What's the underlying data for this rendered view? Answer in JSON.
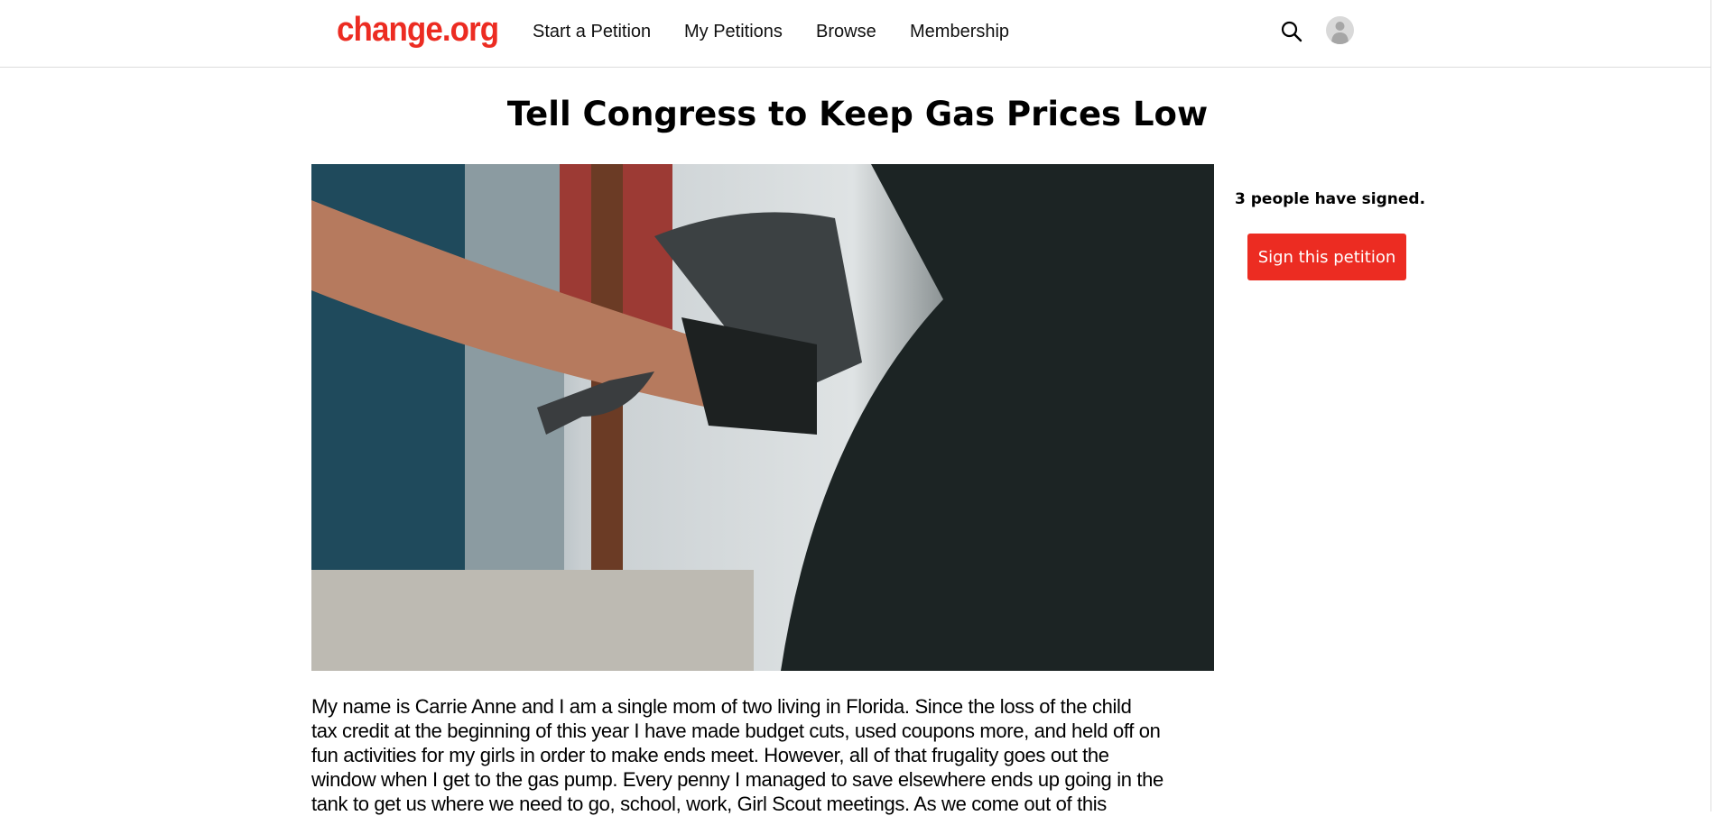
{
  "header": {
    "logo": "change.org",
    "nav": [
      "Start a Petition",
      "My Petitions",
      "Browse",
      "Membership"
    ],
    "icons": [
      "search-icon",
      "avatar-icon"
    ]
  },
  "petition": {
    "title": "Tell Congress to Keep Gas Prices Low",
    "image_alt": "Hand pumping gas into a car",
    "signed_text": "3 people have signed.",
    "sign_button": "Sign this petition",
    "body_lines": [
      "My name is Carrie Anne and I am a single mom of two living in Florida. Since the loss of the child",
      "tax credit at the beginning of this year I have made budget cuts, used coupons more, and held off on",
      "fun activities for my girls in order to make ends meet. However, all of that frugality goes out the",
      "window when I get to the gas pump. Every penny I managed to save elsewhere ends up going in the",
      "tank to get us where we need to go, school, work, Girl Scout meetings. As we come out of this"
    ]
  },
  "colors": {
    "brand": "#ec2c22",
    "text": "#000000",
    "border": "#dddddd"
  }
}
